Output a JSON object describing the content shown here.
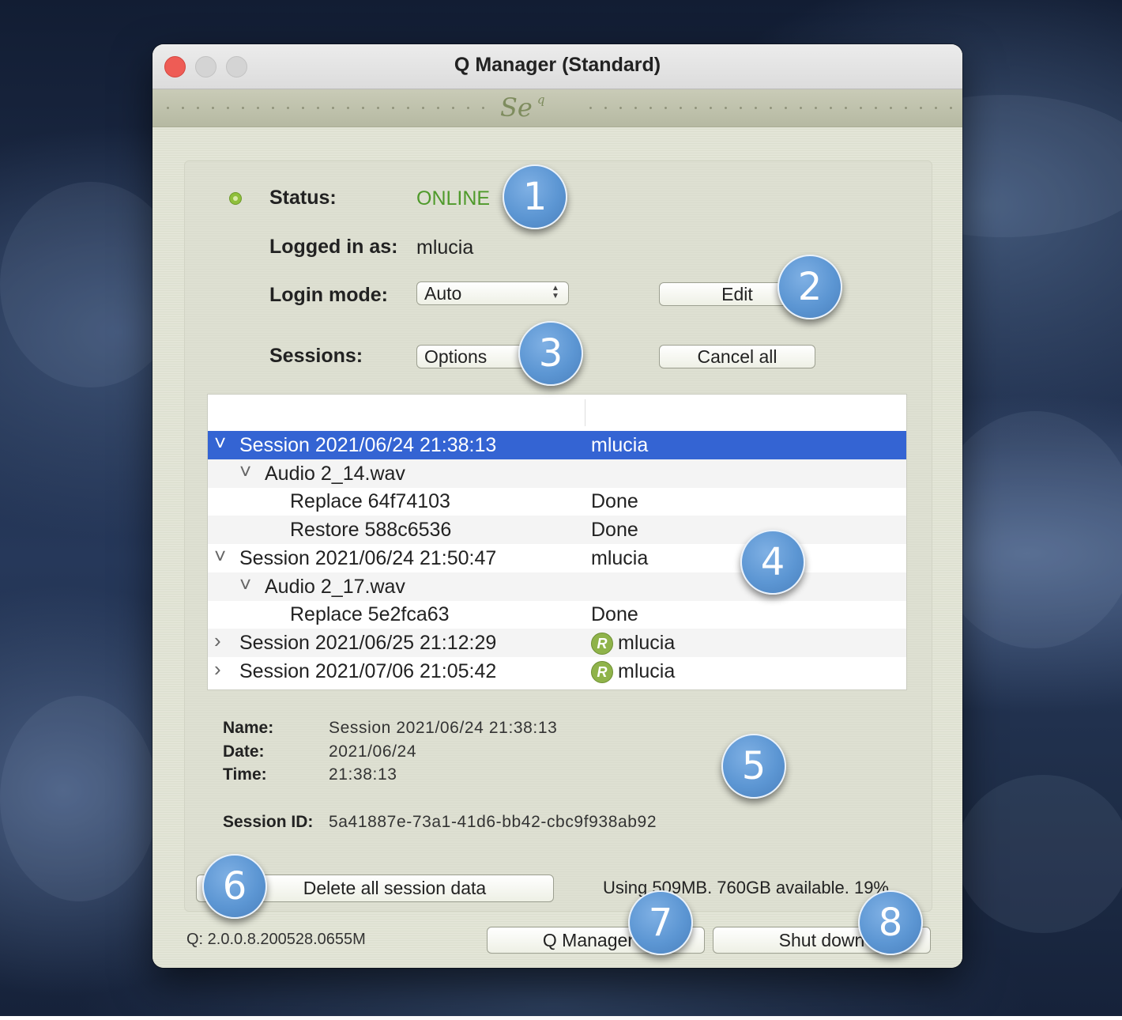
{
  "window": {
    "title": "Q Manager (Standard)",
    "brand_logo": "Se",
    "brand_logo_sup": "q"
  },
  "status": {
    "label": "Status:",
    "value": "ONLINE"
  },
  "logged_in": {
    "label": "Logged in as:",
    "value": "mlucia"
  },
  "login_mode": {
    "label": "Login mode:",
    "value": "Auto",
    "edit_button": "Edit"
  },
  "sessions": {
    "label": "Sessions:",
    "options_value": "Options",
    "cancel_all_button": "Cancel all"
  },
  "session_tree": [
    {
      "level": 0,
      "disclosure": "expanded",
      "name": "Session 2021/06/24 21:38:13",
      "status": "mlucia",
      "selected": true,
      "icon": ""
    },
    {
      "level": 1,
      "disclosure": "expanded",
      "name": "Audio 2_14.wav",
      "status": "",
      "selected": false,
      "icon": ""
    },
    {
      "level": 2,
      "disclosure": "none",
      "name": "Replace 64f74103",
      "status": "Done",
      "selected": false,
      "icon": ""
    },
    {
      "level": 2,
      "disclosure": "none",
      "name": "Restore 588c6536",
      "status": "Done",
      "selected": false,
      "icon": ""
    },
    {
      "level": 0,
      "disclosure": "expanded",
      "name": "Session 2021/06/24 21:50:47",
      "status": "mlucia",
      "selected": false,
      "icon": ""
    },
    {
      "level": 1,
      "disclosure": "expanded",
      "name": "Audio 2_17.wav",
      "status": "",
      "selected": false,
      "icon": ""
    },
    {
      "level": 2,
      "disclosure": "none",
      "name": "Replace 5e2fca63",
      "status": "Done",
      "selected": false,
      "icon": ""
    },
    {
      "level": 0,
      "disclosure": "collapsed",
      "name": "Session 2021/06/25 21:12:29",
      "status": "mlucia",
      "selected": false,
      "icon": "R"
    },
    {
      "level": 0,
      "disclosure": "collapsed",
      "name": "Session 2021/07/06 21:05:42",
      "status": "mlucia",
      "selected": false,
      "icon": "R"
    }
  ],
  "details": {
    "name_label": "Name:",
    "name_value": "Session 2021/06/24 21:38:13",
    "date_label": "Date:",
    "date_value": "2021/06/24",
    "time_label": "Time:",
    "time_value": "21:38:13",
    "session_id_label": "Session ID:",
    "session_id_value": "5a41887e-73a1-41d6-bb42-cbc9f938ab92"
  },
  "footer": {
    "delete_button": "Delete all session data",
    "usage": "Using 509MB.  760GB available. 19%",
    "version": "Q: 2.0.0.8.200528.0655M",
    "q_manager_button": "Q Manager h",
    "shut_down_button": "Shut down"
  },
  "markers": [
    "1",
    "2",
    "3",
    "4",
    "5",
    "6",
    "7",
    "8"
  ],
  "colors": {
    "online": "#4f9a2b",
    "selection": "#3464d3",
    "marker": "#5c96d3",
    "close": "#ee5c55"
  }
}
